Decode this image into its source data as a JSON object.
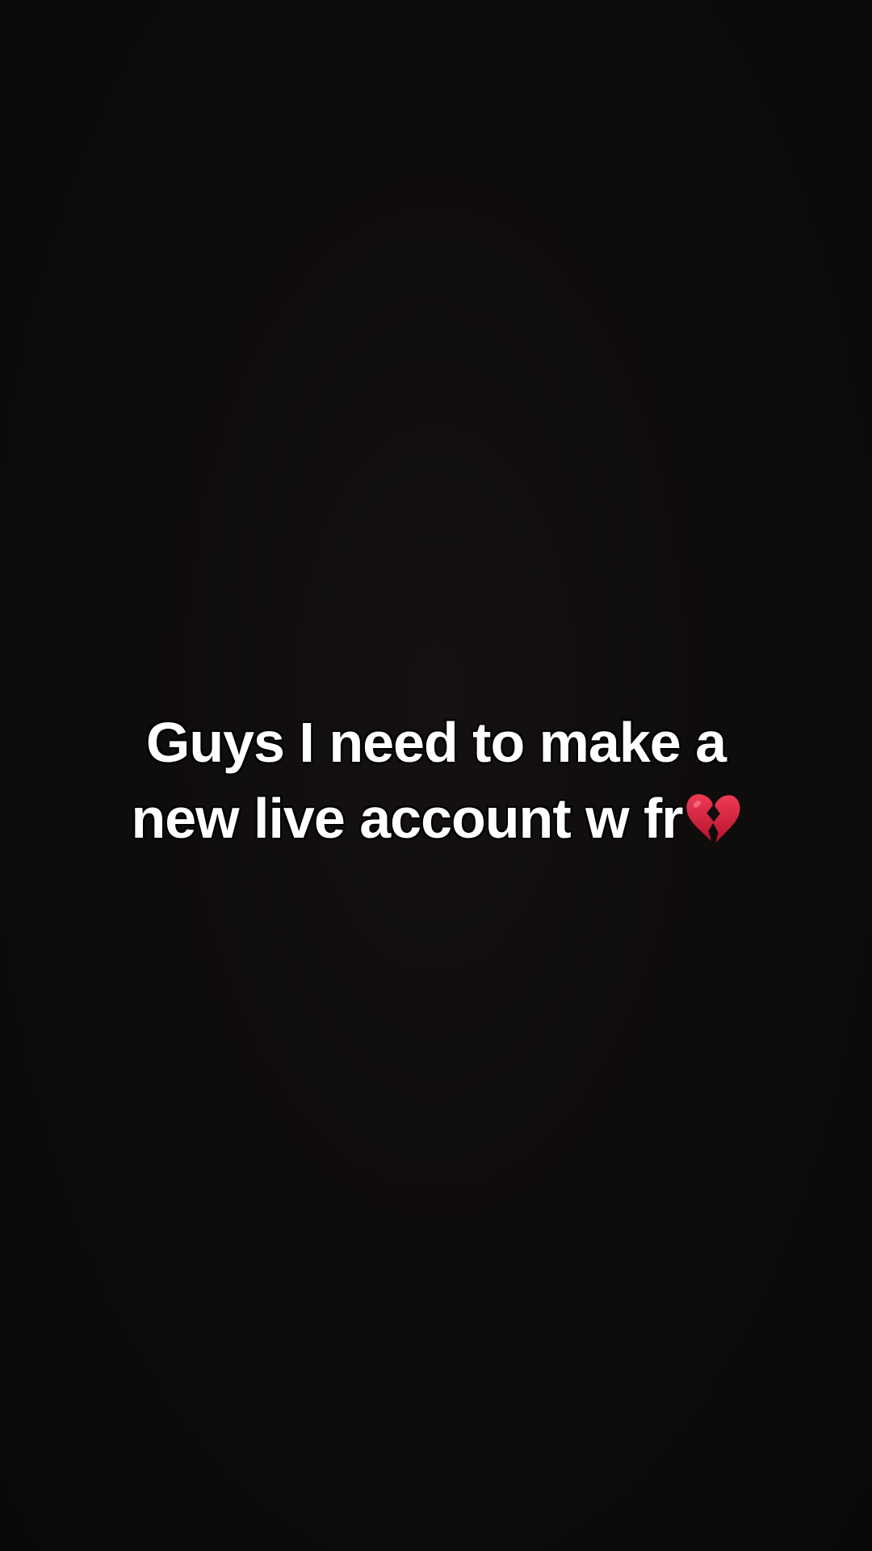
{
  "caption": {
    "line1": "Guys I need to make a",
    "line2": "new live account w fr",
    "emoji_icon": "broken-heart-icon",
    "emoji_color": "#d21f3c"
  }
}
